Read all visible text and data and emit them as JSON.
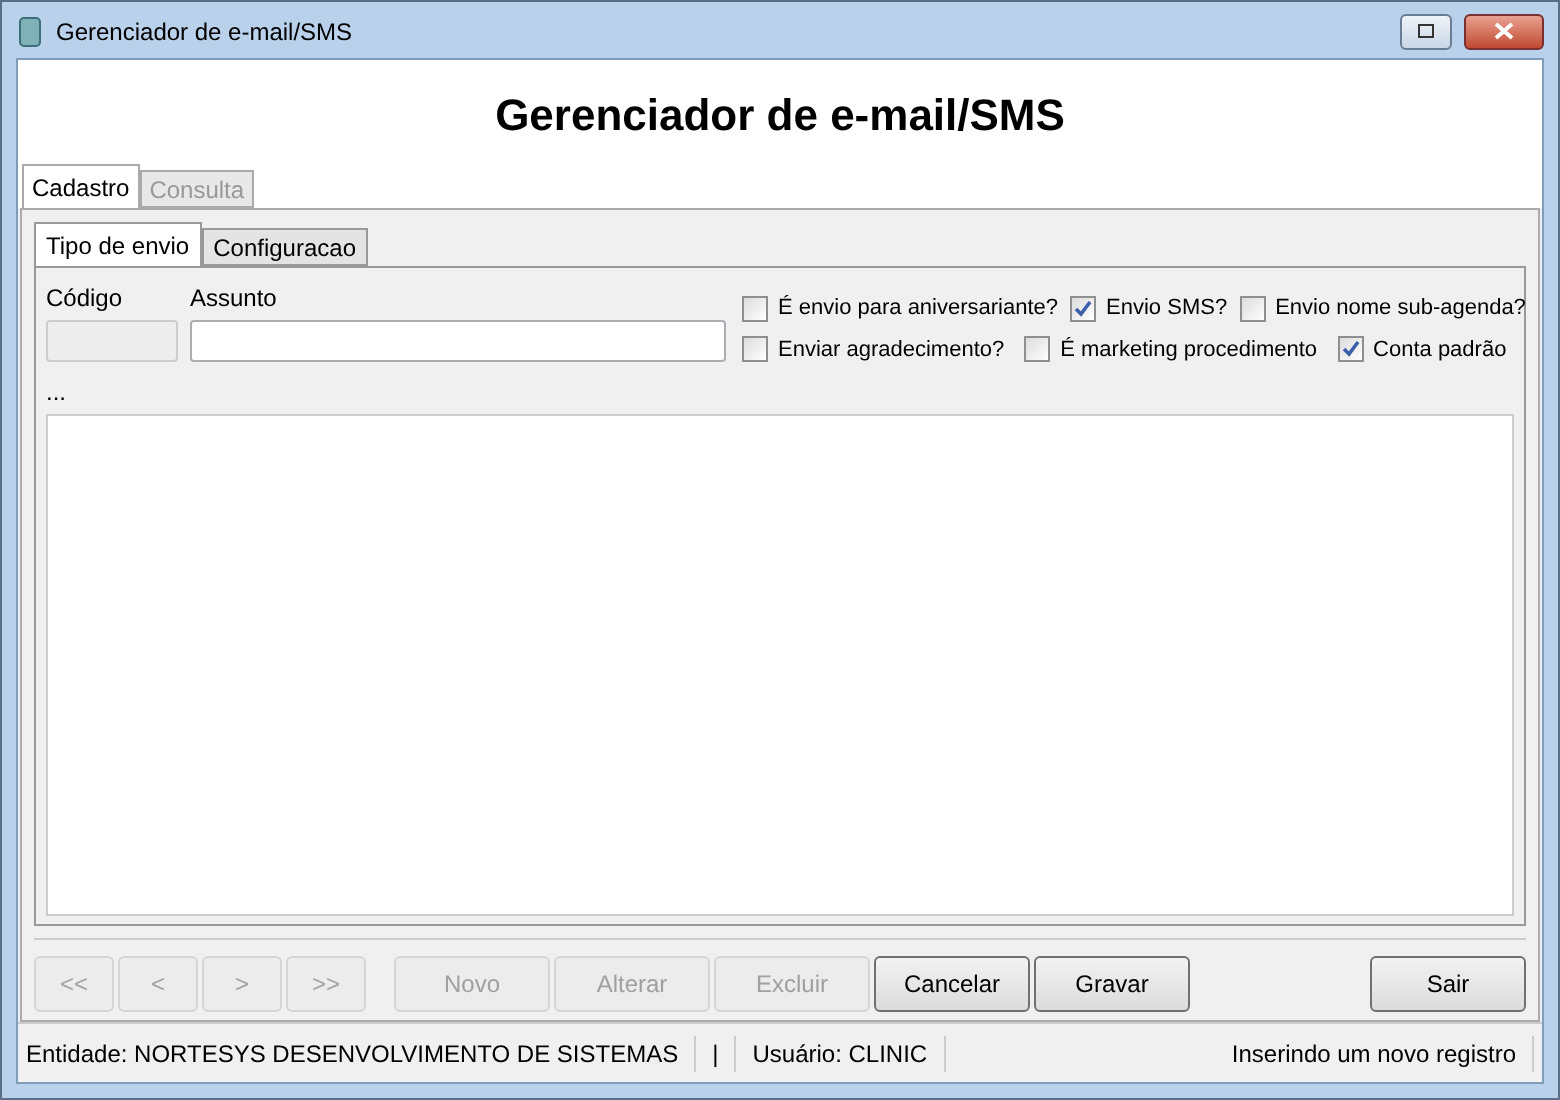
{
  "window": {
    "title": "Gerenciador de e-mail/SMS"
  },
  "heading": "Gerenciador de e-mail/SMS",
  "tabs": [
    {
      "label": "Cadastro",
      "selected": true,
      "disabled": false
    },
    {
      "label": "Consulta",
      "selected": false,
      "disabled": true
    }
  ],
  "subtabs": [
    {
      "label": "Tipo de envio",
      "selected": true
    },
    {
      "label": "Configuracao",
      "selected": false
    }
  ],
  "fields": {
    "codigo": {
      "label": "Código",
      "disabled": true
    },
    "assunto": {
      "label": "Assunto",
      "disabled": false
    }
  },
  "checkbox_rows": [
    [
      {
        "label": "É envio para aniversariante?",
        "checked": false
      },
      {
        "label": "Envio SMS?",
        "checked": true
      },
      {
        "label": "Envio nome sub-agenda?",
        "checked": false
      }
    ],
    [
      {
        "label": "Enviar agradecimento?",
        "checked": false
      },
      {
        "label": "É marketing procedimento",
        "checked": false
      },
      {
        "label": "Conta padrão",
        "checked": true
      }
    ]
  ],
  "memo_label": "...",
  "nav_buttons": [
    {
      "label": "<<",
      "disabled": true
    },
    {
      "label": "<",
      "disabled": true
    },
    {
      "label": ">",
      "disabled": true
    },
    {
      "label": ">>",
      "disabled": true
    }
  ],
  "action_buttons": [
    {
      "label": "Novo",
      "disabled": true
    },
    {
      "label": "Alterar",
      "disabled": true
    },
    {
      "label": "Excluir",
      "disabled": true
    },
    {
      "label": "Cancelar",
      "disabled": false
    },
    {
      "label": "Gravar",
      "disabled": false
    }
  ],
  "exit_button": {
    "label": "Sair",
    "disabled": false
  },
  "status_bar": {
    "entity": "Entidade: NORTESYS DESENVOLVIMENTO DE SISTEMAS",
    "separator": "|",
    "user": "Usuário: CLINIC",
    "message": "Inserindo um novo registro"
  }
}
